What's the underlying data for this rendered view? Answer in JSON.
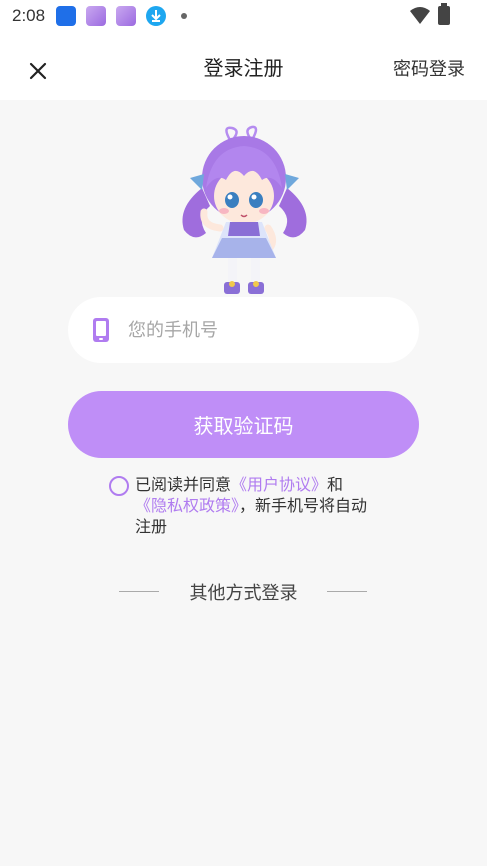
{
  "status_bar": {
    "time": "2:08"
  },
  "header": {
    "title": "登录注册",
    "password_login_label": "密码登录",
    "close_icon": "close-icon"
  },
  "form": {
    "phone_placeholder": "您的手机号",
    "phone_value": "",
    "get_code_label": "获取验证码"
  },
  "agreement": {
    "prefix": "已阅读并同意",
    "user_agreement": "《用户协议》",
    "conjunction": "和",
    "privacy_policy": "《隐私权政策》",
    "suffix": "，新手机号将自动注册",
    "checked": false
  },
  "other_login": {
    "label": "其他方式登录"
  },
  "colors": {
    "accent": "#bf8ef7",
    "link": "#b07cf0",
    "background": "#f7f7f7"
  }
}
